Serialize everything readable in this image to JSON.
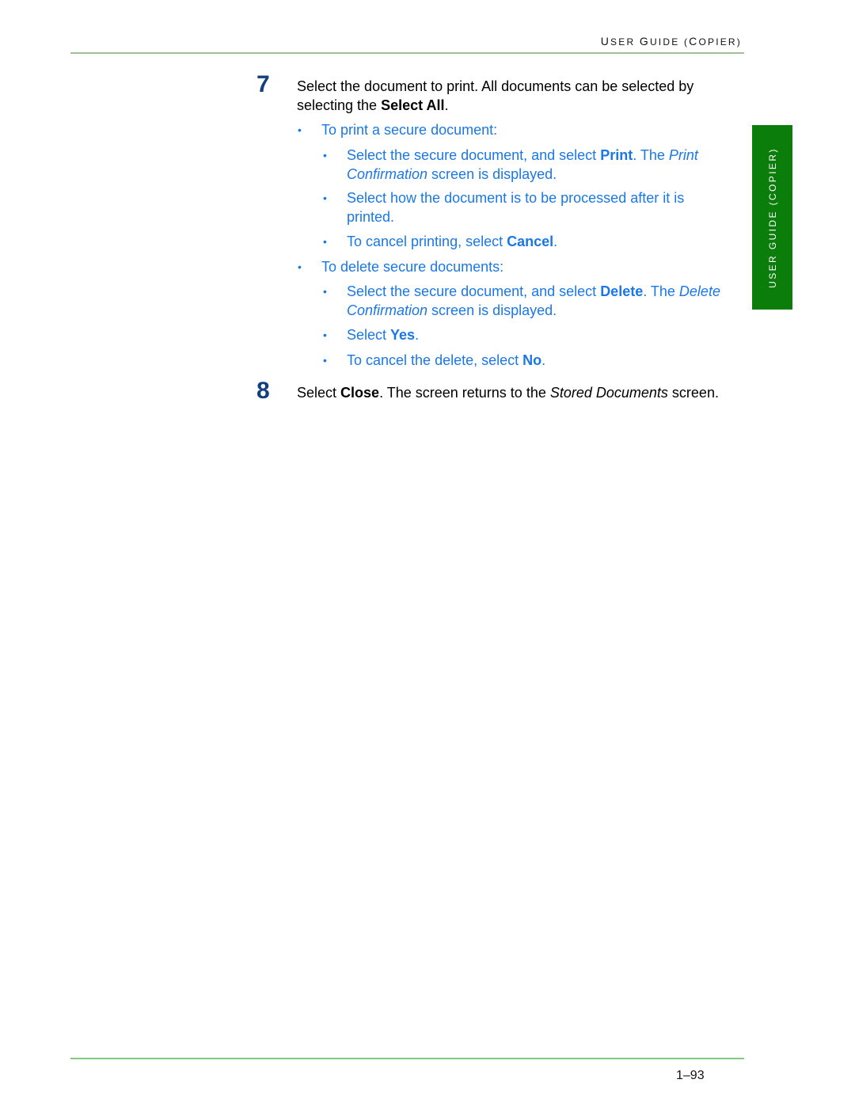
{
  "header": {
    "title_parts": [
      {
        "big": "U",
        "small": "SER "
      },
      {
        "big": "G",
        "small": "UIDE ("
      },
      {
        "big": "C",
        "small": "OPIER)"
      }
    ]
  },
  "side_tab": {
    "label": "USER GUIDE (COPIER)"
  },
  "steps": [
    {
      "number": "7",
      "text_1": "Select the document to print. All documents can be selected by selecting the ",
      "bold_1": "Select All",
      "text_2": "."
    },
    {
      "number": "8",
      "text_1": "Select ",
      "bold_1": "Close",
      "text_2": ". The screen returns to the ",
      "italic_1": "Stored Documents",
      "text_3": " screen."
    }
  ],
  "bullets": {
    "print_secure": {
      "label": "To print a secure document:",
      "items": [
        {
          "t1": "Select the secure document, and select ",
          "b1": "Print",
          "t2": ". The ",
          "i1": "Print Confirmation",
          "t3": " screen is displayed."
        },
        {
          "t1": "Select how the document is to be processed after it is printed."
        },
        {
          "t1": "To cancel printing, select ",
          "b1": "Cancel",
          "t2": "."
        }
      ]
    },
    "delete_secure": {
      "label": "To delete secure documents:",
      "items": [
        {
          "t1": "Select the secure document, and select ",
          "b1": "Delete",
          "t2": ". The ",
          "i1": "Delete Confirmation",
          "t3": " screen is displayed."
        },
        {
          "t1": "Select ",
          "b1": "Yes",
          "t2": "."
        },
        {
          "t1": "To cancel the delete, select ",
          "b1": "No",
          "t2": "."
        }
      ]
    },
    "bullet_glyph": "•"
  },
  "footer": {
    "page_number": "1–93"
  },
  "colors": {
    "step_number": "#123f7e",
    "blue_text": "#1a78e6",
    "side_tab_bg": "#0a7d0a",
    "rule_top": "#a3bf9a",
    "rule_bottom": "#7fcc7f"
  }
}
